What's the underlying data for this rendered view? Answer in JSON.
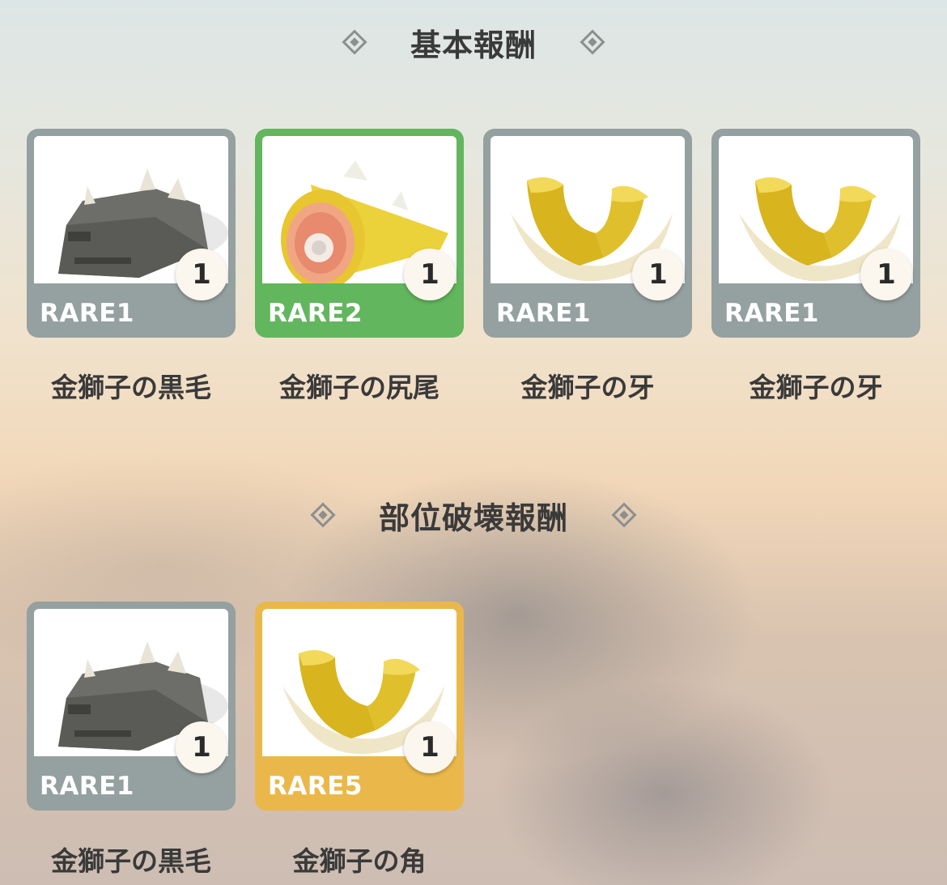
{
  "sections": [
    {
      "title": "基本報酬",
      "items": [
        {
          "rarity": "RARE1",
          "quantity": "1",
          "name": "金獅子の黒毛",
          "color": "#95a0a0",
          "icon": "black-fur-icon"
        },
        {
          "rarity": "RARE2",
          "quantity": "1",
          "name": "金獅子の尻尾",
          "color": "#62b65e",
          "icon": "tail-icon"
        },
        {
          "rarity": "RARE1",
          "quantity": "1",
          "name": "金獅子の牙",
          "color": "#95a0a0",
          "icon": "fang-icon"
        },
        {
          "rarity": "RARE1",
          "quantity": "1",
          "name": "金獅子の牙",
          "color": "#95a0a0",
          "icon": "fang-icon"
        }
      ]
    },
    {
      "title": "部位破壊報酬",
      "items": [
        {
          "rarity": "RARE1",
          "quantity": "1",
          "name": "金獅子の黒毛",
          "color": "#95a0a0",
          "icon": "black-fur-icon"
        },
        {
          "rarity": "RARE5",
          "quantity": "1",
          "name": "金獅子の角",
          "color": "#eab84a",
          "icon": "horn-icon"
        }
      ]
    }
  ]
}
